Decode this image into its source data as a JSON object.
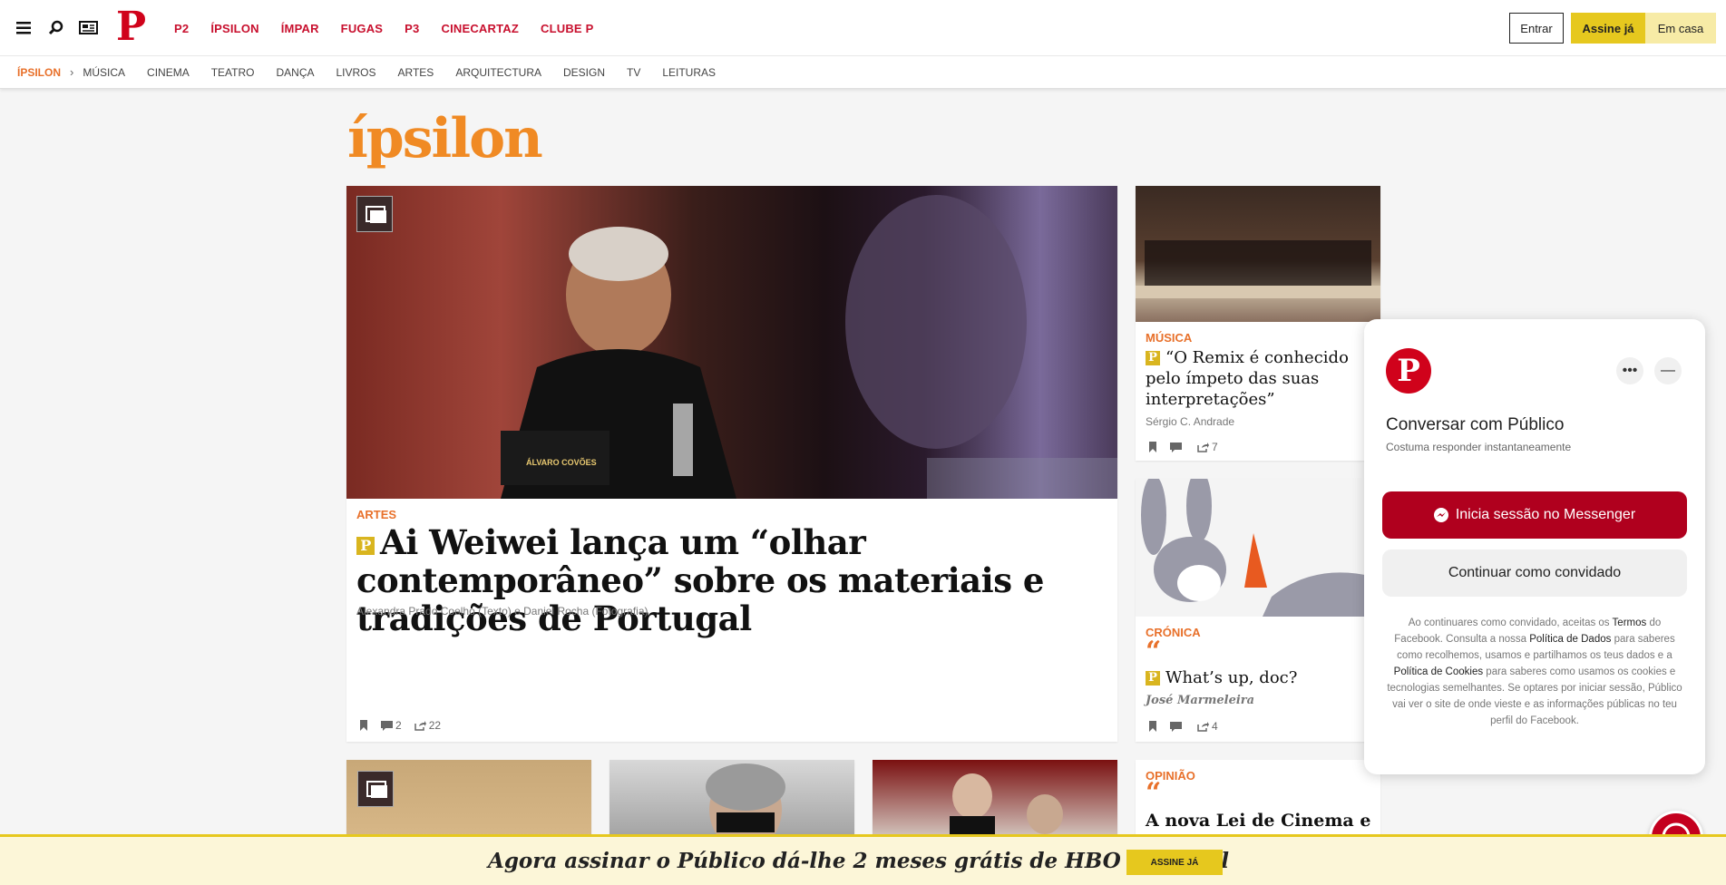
{
  "brand": {
    "logo": "P",
    "logo_color": "#d0021b"
  },
  "top_nav": [
    "P2",
    "ÍPSILON",
    "ÍMPAR",
    "FUGAS",
    "P3",
    "CINECARTAZ",
    "CLUBE P"
  ],
  "account": {
    "login": "Entrar",
    "subscribe": "Assine já",
    "home": "Em casa"
  },
  "section_nav": {
    "current": "ÍPSILON",
    "items": [
      "MÚSICA",
      "CINEMA",
      "TEATRO",
      "DANÇA",
      "LIVROS",
      "ARTES",
      "ARQUITECTURA",
      "DESIGN",
      "TV",
      "LEITURAS"
    ]
  },
  "section_logo": "ípsilon",
  "main_article": {
    "category": "ARTES",
    "premium_badge": "P",
    "title": "Ai Weiwei lança um “olhar contemporâneo” sobre os materiais e tradições de Portugal",
    "author": "Alexandra Prado Coelho (Texto) e Daniel Rocha (Fotografia)",
    "comments": "2",
    "shares": "22",
    "image_caption_text": "ÁLVARO COVÕES"
  },
  "side_articles": [
    {
      "category": "MÚSICA",
      "title": "“O Remix é conhecido pelo ímpeto das suas interpretações”",
      "author": "Sérgio C. Andrade",
      "comments": "",
      "shares": "7"
    },
    {
      "category": "CRÓNICA",
      "title": "What’s up, doc?",
      "author": "José Marmeleira",
      "comments": "",
      "shares": "4"
    },
    {
      "category": "OPINIÃO",
      "title": "A nova Lei de Cinema e o"
    }
  ],
  "chat": {
    "title": "Conversar com Público",
    "subtitle": "Costuma responder instantaneamente",
    "login_button": "Inicia sessão no Messenger",
    "guest_button": "Continuar como convidado",
    "legal_1": "Ao continuares como convidado, aceitas os ",
    "legal_terms": "Termos",
    "legal_2": " do Facebook. Consulta a nossa ",
    "legal_data": "Política de Dados",
    "legal_3": " para saberes como recolhemos, usamos e partilhamos os teus dados e a ",
    "legal_cookies": "Política de Cookies",
    "legal_4": " para saberes como usamos os cookies e tecnologias semelhantes. Se optares por iniciar sessão, Público vai ver o site de onde vieste e as informações públicas no teu perfil do Facebook."
  },
  "promo": {
    "text": "Agora assinar o Público dá-lhe 2 meses grátis de HBO Portugal",
    "button": "ASSINE JÁ"
  },
  "colors": {
    "accent": "#e8702a",
    "brand_red": "#c8102e",
    "gold": "#e6c81e"
  }
}
